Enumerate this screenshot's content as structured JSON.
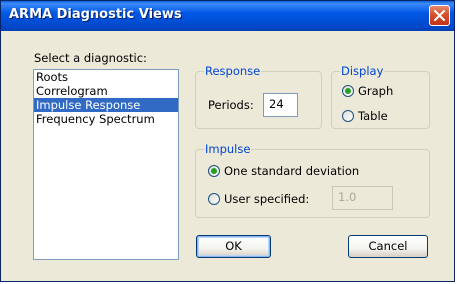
{
  "window": {
    "title": "ARMA Diagnostic Views"
  },
  "diagnostic": {
    "label": "Select a diagnostic:",
    "items": [
      {
        "label": "Roots"
      },
      {
        "label": "Correlogram"
      },
      {
        "label": "Impulse Response",
        "selected": true
      },
      {
        "label": "Frequency Spectrum"
      }
    ]
  },
  "response": {
    "legend": "Response",
    "periods_label": "Periods:",
    "periods_value": "24"
  },
  "display": {
    "legend": "Display",
    "graph_label": "Graph",
    "table_label": "Table",
    "selected": "Graph"
  },
  "impulse": {
    "legend": "Impulse",
    "std_label": "One standard deviation",
    "user_label": "User specified:",
    "user_value": "1.0",
    "selected": "One standard deviation"
  },
  "buttons": {
    "ok": "OK",
    "cancel": "Cancel"
  },
  "colors": {
    "titlebar": "#0058e6",
    "selection": "#316ac5",
    "legend_text": "#0046d5",
    "radio_dot": "#21a121",
    "close_button": "#d5512d"
  }
}
